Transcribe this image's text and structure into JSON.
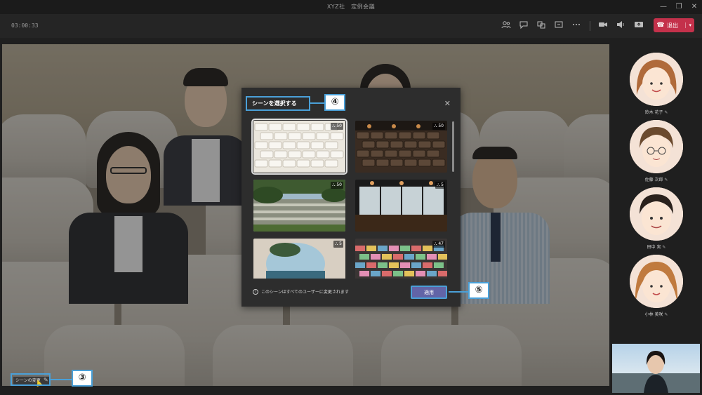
{
  "window": {
    "title": "XYZ社　定例会議",
    "minimize_glyph": "—",
    "restore_glyph": "❐",
    "close_glyph": "✕"
  },
  "toolbar": {
    "timer": "03:00:33",
    "icons": [
      "participants-icon",
      "chat-icon",
      "reactions-icon",
      "share-icon",
      "more-icon",
      "camera-icon",
      "speaker-icon",
      "screen-share-icon"
    ],
    "leave_label": "退出",
    "leave_color": "#c4314b"
  },
  "scene_button": {
    "label": "シーンの変更"
  },
  "dialog": {
    "title": "シーンを選択する",
    "close_glyph": "✕",
    "scenes": [
      {
        "name": "white-brick-wall-scene",
        "count": "50",
        "selected": true
      },
      {
        "name": "dark-brick-wall-scene",
        "count": "50",
        "selected": false
      },
      {
        "name": "garden-steps-scene",
        "count": "50",
        "selected": false
      },
      {
        "name": "cafe-window-scene",
        "count": "5",
        "selected": false
      },
      {
        "name": "round-window-scene",
        "count": "5",
        "selected": false
      },
      {
        "name": "colorful-stadium-scene",
        "count": "47",
        "selected": false
      }
    ],
    "info_text": "このシーンはすべてのユーザーに変更されます",
    "apply_label": "適用",
    "accent": "#6264a7"
  },
  "callouts": {
    "scene_button": "③",
    "dialog_title": "④",
    "apply_button": "⑤",
    "color": "#4aa0d8"
  },
  "participants": [
    {
      "name": "鈴木 花子",
      "status_icon": "mic-off-icon"
    },
    {
      "name": "佐藤 次郎",
      "status_icon": "mic-off-icon"
    },
    {
      "name": "田中 実",
      "status_icon": "mic-off-icon"
    },
    {
      "name": "小林 美咲",
      "status_icon": "mic-off-icon"
    }
  ]
}
